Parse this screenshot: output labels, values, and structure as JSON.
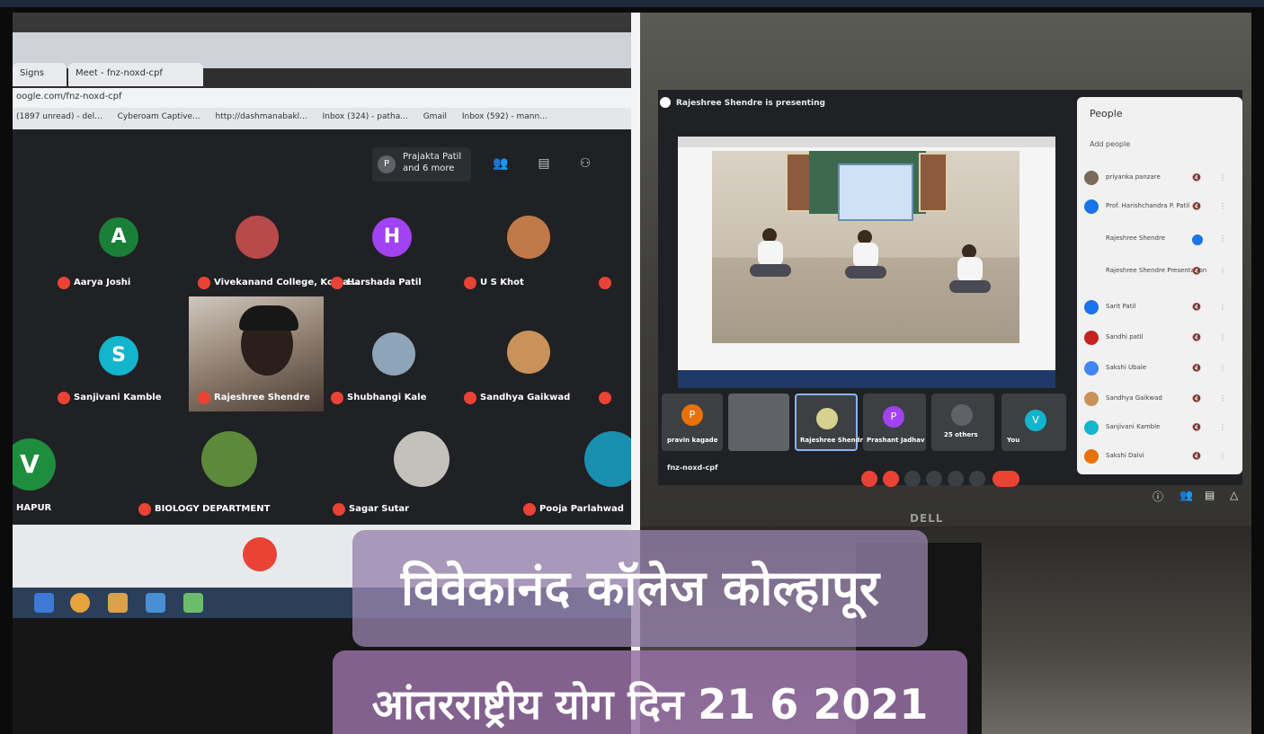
{
  "browser": {
    "tabs": [
      "Signs",
      "Meet - fnz-noxd-cpf"
    ],
    "url": "oogle.com/fnz-noxd-cpf",
    "bookmarks": [
      "(1897 unread) - del...",
      "Cyberoam Captive...",
      "http://dashmanabakl...",
      "Inbox (324) - patha...",
      "Gmail",
      "Inbox (592) - mann..."
    ]
  },
  "left_meet": {
    "presenting": {
      "initial": "P",
      "text": "Prajakta Patil and 6 more"
    },
    "participants": [
      {
        "name": "Aarya Joshi",
        "initial": "A",
        "color": "#188038"
      },
      {
        "name": "Vivekanand College, Kolha...",
        "initial": "",
        "color": "#b94a4a"
      },
      {
        "name": "Harshada Patil",
        "initial": "H",
        "color": "#a142f4"
      },
      {
        "name": "U S Khot",
        "initial": "",
        "color": "#c07a4a"
      },
      {
        "name": "Sanjivani Kamble",
        "initial": "S",
        "color": "#12b5cb"
      },
      {
        "name": "Rajeshree Shendre",
        "initial": "",
        "color": "#6b5a4d"
      },
      {
        "name": "Shubhangi Kale",
        "initial": "",
        "color": "#8ea4b8"
      },
      {
        "name": "Sandhya Gaikwad",
        "initial": "",
        "color": "#c9925a"
      },
      {
        "name": "HAPUR",
        "initial": "V",
        "color": "#1e8e3e"
      },
      {
        "name": "BIOLOGY DEPARTMENT",
        "initial": "",
        "color": "#5c8a3a"
      },
      {
        "name": "Sagar Sutar",
        "initial": "",
        "color": "#c4c0bb"
      },
      {
        "name": "Pooja Parlahwad",
        "initial": "",
        "color": "#1a8fb0"
      }
    ]
  },
  "right_meet": {
    "presenting_text": "Rajeshree Shendre is presenting",
    "meeting_code": "fnz-noxd-cpf",
    "thumbnails": [
      {
        "name": "pravin kagade",
        "initial": "P",
        "color": "#e8710a"
      },
      {
        "name": "",
        "initial": "",
        "color": "#5f6368"
      },
      {
        "name": "Rajeshree Shendre",
        "initial": "",
        "color": "#d6d18e"
      },
      {
        "name": "Prashant Jadhav",
        "initial": "P",
        "color": "#a142f4"
      },
      {
        "name": "25 others",
        "initial": "",
        "color": "#5f6368"
      },
      {
        "name": "You",
        "initial": "V",
        "color": "#12b5cb"
      }
    ],
    "people_panel": {
      "title": "People",
      "add_label": "Add people",
      "people": [
        {
          "name": "priyanka panzare",
          "color": "#7b6a58"
        },
        {
          "name": "Prof. Harishchandra P. Patil",
          "color": "#1a73e8"
        },
        {
          "name": "Rajeshree Shendre",
          "color": "#f1f1f1"
        },
        {
          "name": "Rajeshree Shendre Presentation",
          "color": "#f1f1f1"
        },
        {
          "name": "Sarit Patil",
          "color": "#1a73e8"
        },
        {
          "name": "Sandhi patil",
          "color": "#c5221f"
        },
        {
          "name": "Sakshi Ubale",
          "color": "#4285f4"
        },
        {
          "name": "Sandhya Gaikwad",
          "color": "#c9925a"
        },
        {
          "name": "Sanjivani Kamble",
          "color": "#12b5cb"
        },
        {
          "name": "Sakshi Dalvi",
          "color": "#e8710a"
        }
      ]
    },
    "monitor_brand": "DELL"
  },
  "captions": {
    "line1": "विवेकानंद कॉलेज कोल्हापूर",
    "line2": "आंतरराष्ट्रीय योग दिन 21 6 2021"
  },
  "colors": {
    "meet_bg": "#202124",
    "mic_off": "#ea4335",
    "caption_bg": "#9682aa"
  }
}
